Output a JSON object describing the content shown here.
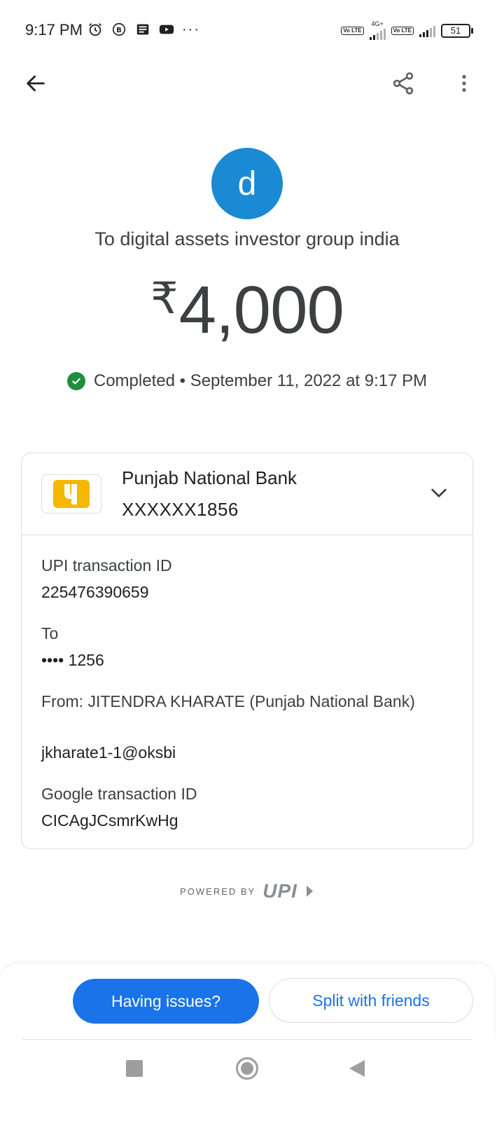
{
  "status_bar": {
    "time": "9:17 PM",
    "left_icons": [
      "alarm-icon",
      "b-app-icon",
      "news-icon",
      "youtube-icon",
      "more-notifications-icon"
    ],
    "more_label": "···",
    "sim1_label": "Vo LTE",
    "network_type": "4G+",
    "sim2_label": "Vo LTE",
    "battery_level": "51"
  },
  "app_bar": {
    "back_icon": "arrow-left-icon",
    "share_icon": "share-icon",
    "menu_icon": "more-vert-icon"
  },
  "transaction": {
    "avatar_letter": "d",
    "avatar_color": "#1a8ad4",
    "payee_line": "To digital assets investor group india",
    "currency_symbol": "₹",
    "amount": "4,000",
    "status": "Completed",
    "separator": " • ",
    "datetime": "September 11, 2022 at 9:17 PM",
    "status_color": "#1e8e3e"
  },
  "bank": {
    "name": "Punjab National Bank",
    "account": "XXXXXX1856",
    "logo_color": "#f5b800"
  },
  "details": {
    "upi_label": "UPI transaction ID",
    "upi_value": "225476390659",
    "to_label": "To",
    "to_value": "•••• 1256",
    "from_label": "From: JITENDRA KHARATE (Punjab National Bank)",
    "from_value": "jkharate1-1@oksbi",
    "google_label": "Google transaction ID",
    "google_value": "CICAgJCsmrKwHg"
  },
  "footer": {
    "powered_by": "POWERED BY",
    "upi_logo_text": "UPI",
    "issues_button": "Having issues?",
    "split_button": "Split with friends",
    "primary_color": "#1a73e8"
  }
}
